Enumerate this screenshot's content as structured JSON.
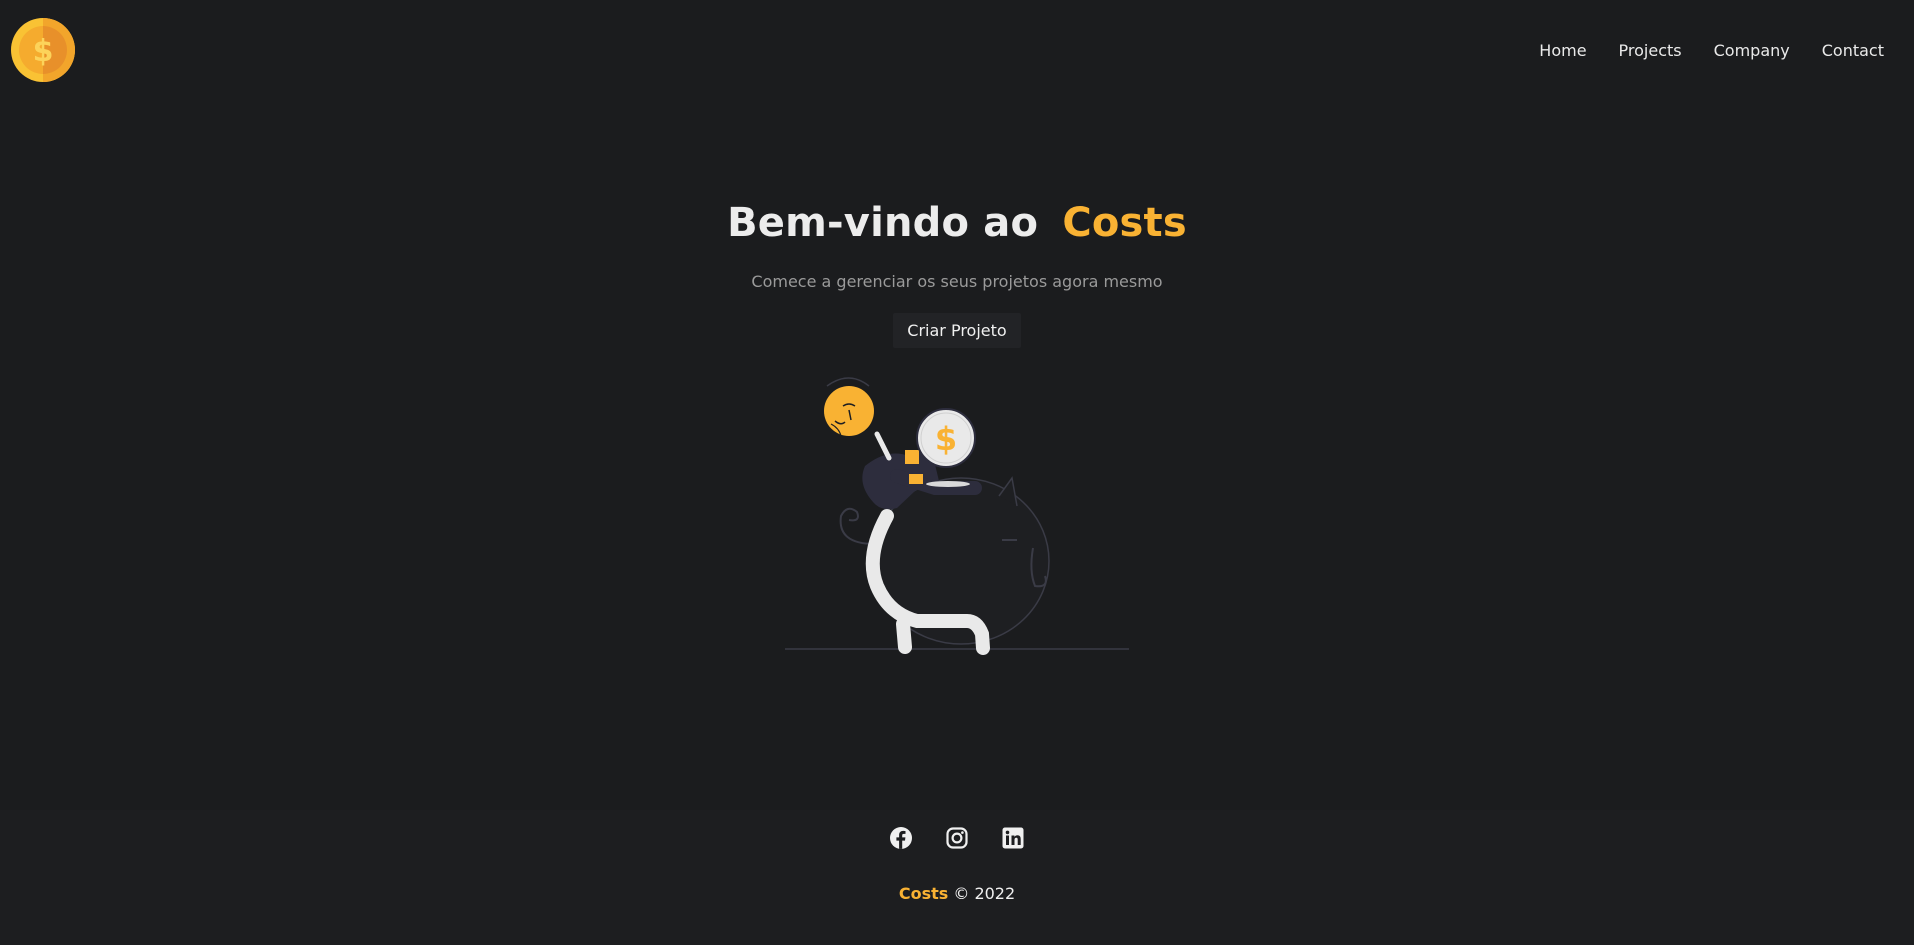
{
  "nav": {
    "logo_icon": "dollar-coin-icon",
    "links": [
      "Home",
      "Projects",
      "Company",
      "Contact"
    ]
  },
  "hero": {
    "title_prefix": "Bem-vindo ao",
    "title_brand": "Costs",
    "subtitle": "Comece a gerenciar os seus projetos agora mesmo",
    "button_label": "Criar Projeto",
    "illustration": "piggy-bank-savings-illustration"
  },
  "footer": {
    "social_icons": [
      "facebook-icon",
      "instagram-icon",
      "linkedin-icon"
    ],
    "brand": "Costs",
    "copyright": "© 2022"
  },
  "colors": {
    "background": "#1b1c1e",
    "accent": "#f9b233",
    "text": "#e6e6e6",
    "muted": "#9a9a9a"
  }
}
